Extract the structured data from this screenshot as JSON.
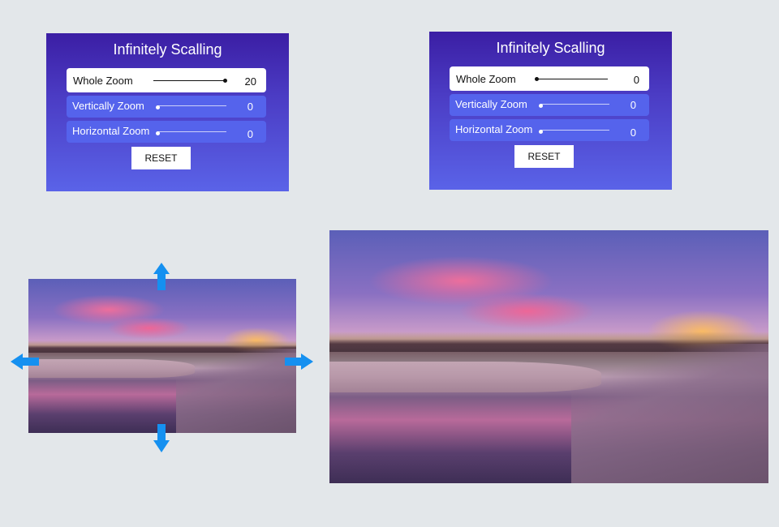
{
  "panels": [
    {
      "title": "Infinitely Scalling",
      "rows": [
        {
          "label": "Whole Zoom",
          "value": "20",
          "fraction": 1.0
        },
        {
          "label": "Vertically Zoom",
          "value": "0",
          "fraction": 0.0
        },
        {
          "label": "Horizontal Zoom",
          "value": "0",
          "fraction": 0.0
        }
      ],
      "reset_label": "RESET"
    },
    {
      "title": "Infinitely Scalling",
      "rows": [
        {
          "label": "Whole Zoom",
          "value": "0",
          "fraction": 0.0
        },
        {
          "label": "Vertically Zoom",
          "value": "0",
          "fraction": 0.0
        },
        {
          "label": "Horizontal Zoom",
          "value": "0",
          "fraction": 0.0
        }
      ],
      "reset_label": "RESET"
    }
  ],
  "images": {
    "small": {
      "description": "sunset river landscape with frosted grass (original scale)"
    },
    "large": {
      "description": "sunset river landscape with frosted grass (zoomed)"
    }
  },
  "arrows": [
    "arrow-up-icon",
    "arrow-down-icon",
    "arrow-left-icon",
    "arrow-right-icon"
  ],
  "colors": {
    "background": "#e3e7ea",
    "panel_top": "#3b1ea4",
    "panel_bottom": "#5a63e8",
    "row_bg": "#5563ec",
    "arrow": "#1590f0"
  }
}
